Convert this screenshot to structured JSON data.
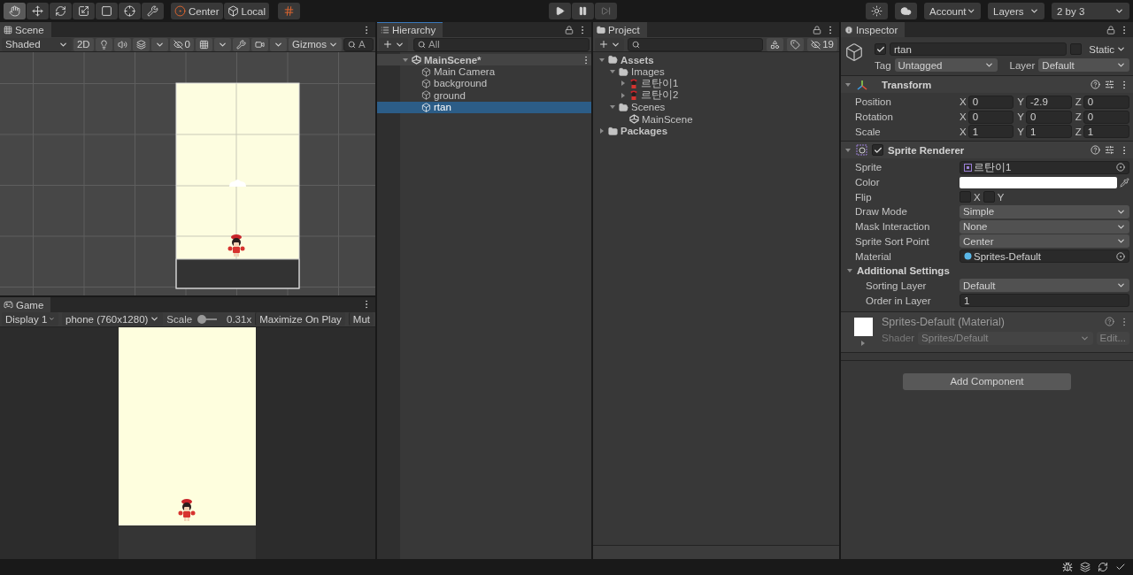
{
  "toolbar": {
    "tools": [
      {
        "kind": "hand",
        "selected": true
      },
      {
        "kind": "move",
        "selected": false
      },
      {
        "kind": "rotate",
        "selected": false
      },
      {
        "kind": "scale",
        "selected": false
      },
      {
        "kind": "rect",
        "selected": false
      },
      {
        "kind": "transform",
        "selected": false
      },
      {
        "kind": "custom",
        "selected": false
      }
    ],
    "pivot": [
      {
        "kind": "center",
        "label": "Center"
      },
      {
        "kind": "local",
        "label": "Local"
      }
    ],
    "account": "Account",
    "layers": "Layers",
    "layout": "2 by 3"
  },
  "scene": {
    "tab": "Scene",
    "draw_mode": "Shaded",
    "mode_2d": "2D",
    "hidden_count": "0",
    "gizmos": "Gizmos",
    "search_placeholder": "A"
  },
  "game": {
    "tab": "Game",
    "display": "Display 1",
    "resolution": "phone (760x1280)",
    "scale_label": "Scale",
    "scale": {
      "level": 0,
      "reading": "0.31x"
    },
    "buttons": [
      "Maximize On Play",
      "Mut"
    ]
  },
  "hierarchy": {
    "tab": "Hierarchy",
    "search_placeholder": "All",
    "scene": {
      "label": "MainScene*",
      "expanded": true,
      "children": [
        {
          "label": "Main Camera",
          "selected": false
        },
        {
          "label": "background",
          "selected": false
        },
        {
          "label": "ground",
          "selected": false
        },
        {
          "label": "rtan",
          "selected": true
        }
      ]
    }
  },
  "project": {
    "tab": "Project",
    "hidden_count": "19",
    "tree": [
      {
        "label": "Assets",
        "kind": "folder",
        "expanded": true,
        "children": [
          {
            "label": "Images",
            "kind": "folder",
            "expanded": true,
            "children": [
              {
                "label": "르탄이1",
                "kind": "sprite",
                "expanded": false
              },
              {
                "label": "르탄이2",
                "kind": "sprite",
                "expanded": false
              }
            ]
          },
          {
            "label": "Scenes",
            "kind": "folder",
            "expanded": true,
            "children": [
              {
                "label": "MainScene",
                "kind": "scene"
              }
            ]
          }
        ]
      },
      {
        "label": "Packages",
        "kind": "folder",
        "expanded": false
      }
    ]
  },
  "inspector": {
    "tab": "Inspector",
    "object": {
      "active": true,
      "name": "rtan",
      "static": false,
      "static_label": "Static",
      "tag_label": "Tag",
      "tag": "Untagged",
      "layer_label": "Layer",
      "layer": "Default"
    },
    "transform": {
      "title": "Transform",
      "expanded": true,
      "rows": [
        {
          "label": "Position",
          "axes": [
            {
              "axis": "X",
              "value": "0"
            },
            {
              "axis": "Y",
              "value": "-2.9"
            },
            {
              "axis": "Z",
              "value": "0"
            }
          ]
        },
        {
          "label": "Rotation",
          "axes": [
            {
              "axis": "X",
              "value": "0"
            },
            {
              "axis": "Y",
              "value": "0"
            },
            {
              "axis": "Z",
              "value": "0"
            }
          ]
        },
        {
          "label": "Scale",
          "axes": [
            {
              "axis": "X",
              "value": "1"
            },
            {
              "axis": "Y",
              "value": "1"
            },
            {
              "axis": "Z",
              "value": "1"
            }
          ]
        }
      ]
    },
    "sprite_renderer": {
      "title": "Sprite Renderer",
      "expanded": true,
      "enabled": true,
      "properties": [
        {
          "kind": "sprite",
          "label": "Sprite",
          "value": "르탄이1"
        },
        {
          "kind": "color",
          "label": "Color",
          "color": "#ffffff"
        },
        {
          "kind": "flip",
          "label": "Flip",
          "x": {
            "label": "X",
            "checked": false
          },
          "y": {
            "label": "Y",
            "checked": false
          }
        },
        {
          "kind": "dropdown",
          "label": "Draw Mode",
          "value": "Simple"
        },
        {
          "kind": "dropdown",
          "label": "Mask Interaction",
          "value": "None"
        },
        {
          "kind": "dropdown",
          "label": "Sprite Sort Point",
          "value": "Center"
        },
        {
          "kind": "material",
          "label": "Material",
          "value": "Sprites-Default"
        }
      ],
      "additional": {
        "label": "Additional Settings",
        "expanded": true,
        "properties": [
          {
            "kind": "dropdown",
            "label": "Sorting Layer",
            "value": "Default"
          },
          {
            "kind": "field",
            "label": "Order in Layer",
            "value": "1"
          }
        ]
      }
    },
    "material": {
      "name": "Sprites-Default (Material)",
      "expanded": false,
      "shader_label": "Shader",
      "shader": "Sprites/Default",
      "edit": "Edit..."
    },
    "add_component": "Add Component"
  }
}
